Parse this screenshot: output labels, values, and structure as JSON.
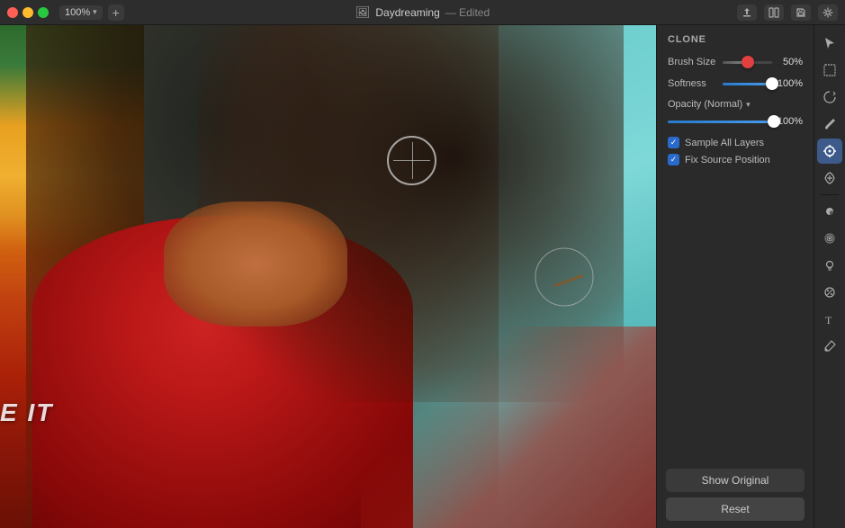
{
  "titlebar": {
    "zoom_label": "100%",
    "doc_title": "Daydreaming",
    "doc_status": "— Edited",
    "add_tab_label": "+"
  },
  "panel": {
    "section_title": "CLONE",
    "brush_size_label": "Brush Size",
    "brush_size_value": "50%",
    "brush_size_pct": 50,
    "softness_label": "Softness",
    "softness_value": "100%",
    "softness_pct": 100,
    "opacity_label": "Opacity (Normal)",
    "opacity_dropdown": "▾",
    "opacity_value": "100%",
    "opacity_pct": 100,
    "sample_all_layers_label": "Sample All Layers",
    "fix_source_position_label": "Fix Source Position",
    "show_original_label": "Show Original",
    "reset_label": "Reset"
  },
  "tools": [
    {
      "name": "cursor-tool",
      "icon": "↖",
      "active": false
    },
    {
      "name": "selection-tool",
      "icon": "⊹",
      "active": false
    },
    {
      "name": "smart-selection-tool",
      "icon": "✦",
      "active": false
    },
    {
      "name": "brush-tool",
      "icon": "✏",
      "active": false
    },
    {
      "name": "clone-tool",
      "icon": "⊕",
      "active": true
    },
    {
      "name": "healing-tool",
      "icon": "✒",
      "active": false
    },
    {
      "name": "eraser-tool",
      "icon": "◻",
      "active": false
    },
    {
      "name": "dodge-burn-tool",
      "icon": "◑",
      "active": false
    },
    {
      "name": "blur-tool",
      "icon": "⊕",
      "active": false
    },
    {
      "name": "paint-tool",
      "icon": "⬧",
      "active": false
    },
    {
      "name": "text-tool",
      "icon": "T",
      "active": false
    },
    {
      "name": "eyedropper-tool",
      "icon": "⊸",
      "active": false
    }
  ]
}
